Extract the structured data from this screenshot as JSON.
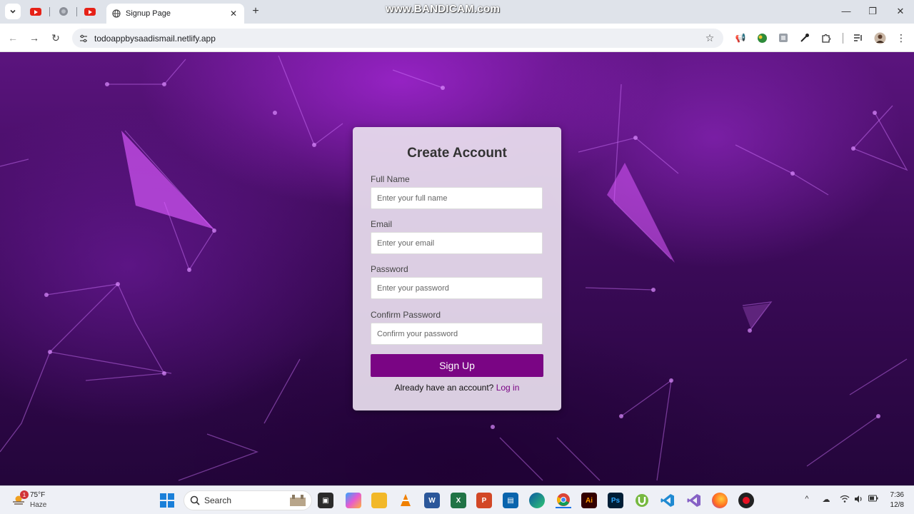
{
  "browser": {
    "tab_title": "Signup Page",
    "url": "todoappbysaadismail.netlify.app",
    "watermark": "www.BANDICAM.com"
  },
  "form": {
    "title": "Create Account",
    "fields": [
      {
        "label": "Full Name",
        "placeholder": "Enter your full name"
      },
      {
        "label": "Email",
        "placeholder": "Enter your email"
      },
      {
        "label": "Password",
        "placeholder": "Enter your password"
      },
      {
        "label": "Confirm Password",
        "placeholder": "Confirm your password"
      }
    ],
    "submit_label": "Sign Up",
    "login_prompt": "Already have an account?",
    "login_link": "Log in"
  },
  "taskbar": {
    "weather_temp": "75°F",
    "weather_condition": "Haze",
    "weather_badge": "1",
    "search_label": "Search",
    "apps": [
      {
        "name": "Adobe Illustrator",
        "text": "Ai",
        "color": "#330000"
      },
      {
        "name": "Adobe Photoshop",
        "text": "Ps",
        "color": "#001e36"
      }
    ],
    "time": "7:36",
    "date": "12/8"
  },
  "colors": {
    "accent": "#7a0584",
    "card_bg": "#e8deee"
  }
}
